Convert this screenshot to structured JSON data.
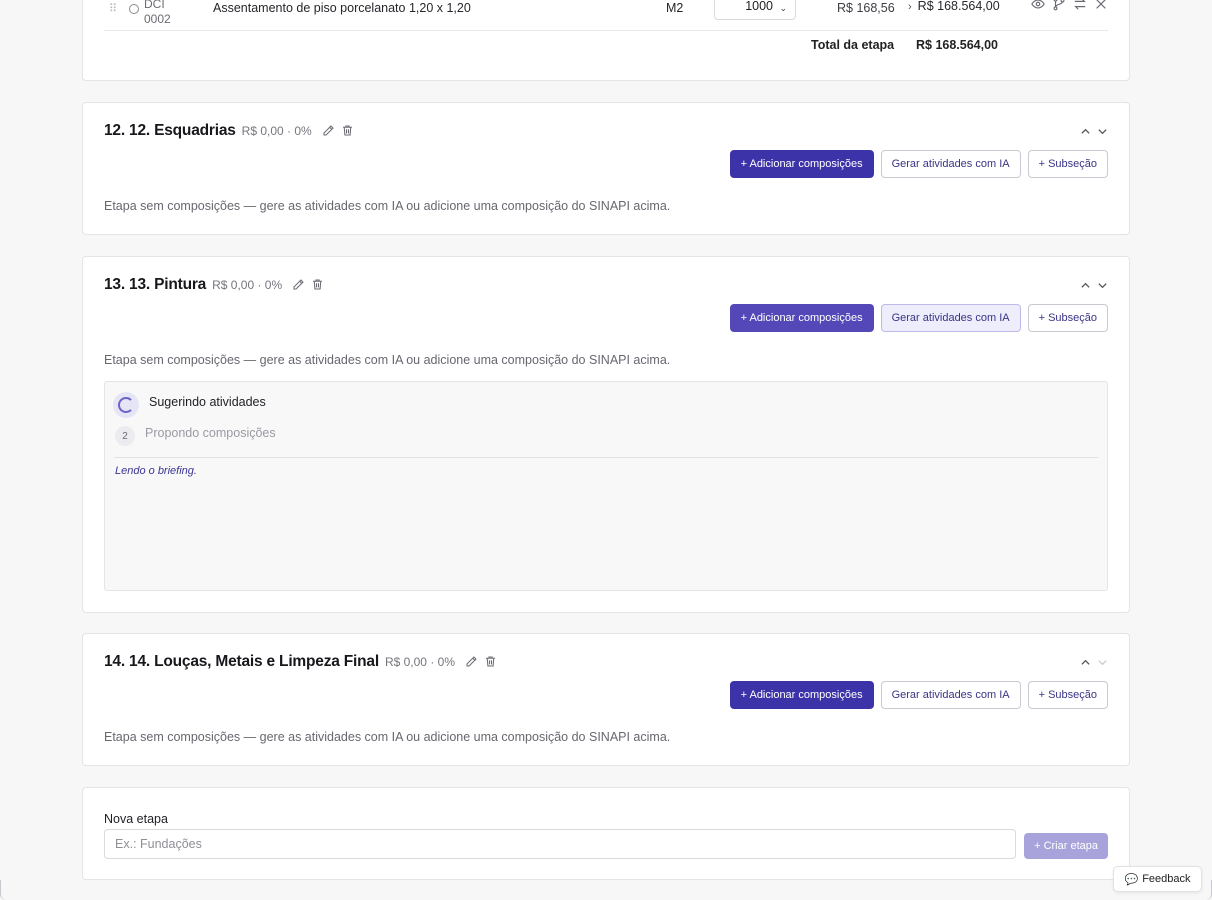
{
  "top_stage": {
    "item": {
      "drag_glyph": "⠿",
      "code_line1": "DCI",
      "code_line2": "0002",
      "description": "Assentamento de piso porcelanato 1,20 x 1,20",
      "unit": "M2",
      "quantity": "1000",
      "unit_price": "R$ 168,56",
      "total_price": "R$ 168.564,00"
    },
    "total_label": "Total da etapa",
    "total_value": "R$ 168.564,00"
  },
  "stages": [
    {
      "title": "12. 12. Esquadrias",
      "meta": "R$ 0,00 · 0%",
      "add_button": "+ Adicionar composições",
      "ai_button": "Gerar atividades com IA",
      "sub_button": "+ Subseção",
      "empty_message": "Etapa sem composições — gere as atividades com IA ou adicione uma composição do SINAPI acima."
    },
    {
      "title": "13. 13. Pintura",
      "meta": "R$ 0,00 · 0%",
      "add_button": "+ Adicionar composições",
      "ai_button": "Gerar atividades com IA",
      "sub_button": "+ Subseção",
      "empty_message": "Etapa sem composições — gere as atividades com IA ou adicione uma composição do SINAPI acima.",
      "ai_panel": {
        "step1_label": "Sugerindo atividades",
        "step2_number": "2",
        "step2_label": "Propondo composições",
        "log_text": "Lendo o briefing."
      }
    },
    {
      "title": "14. 14. Louças, Metais e Limpeza Final",
      "meta": "R$ 0,00 · 0%",
      "add_button": "+ Adicionar composições",
      "ai_button": "Gerar atividades com IA",
      "sub_button": "+ Subseção",
      "empty_message": "Etapa sem composições — gere as atividades com IA ou adicione uma composição do SINAPI acima."
    }
  ],
  "new_stage": {
    "label": "Nova etapa",
    "placeholder": "Ex.: Fundações",
    "create_button": "+ Criar etapa"
  },
  "feedback": {
    "label": "Feedback",
    "icon": "speech-bubble-icon"
  },
  "colors": {
    "primary": "#3c33a8",
    "primary_disabled": "#a9a3dc",
    "accent_text": "#3a3486"
  }
}
